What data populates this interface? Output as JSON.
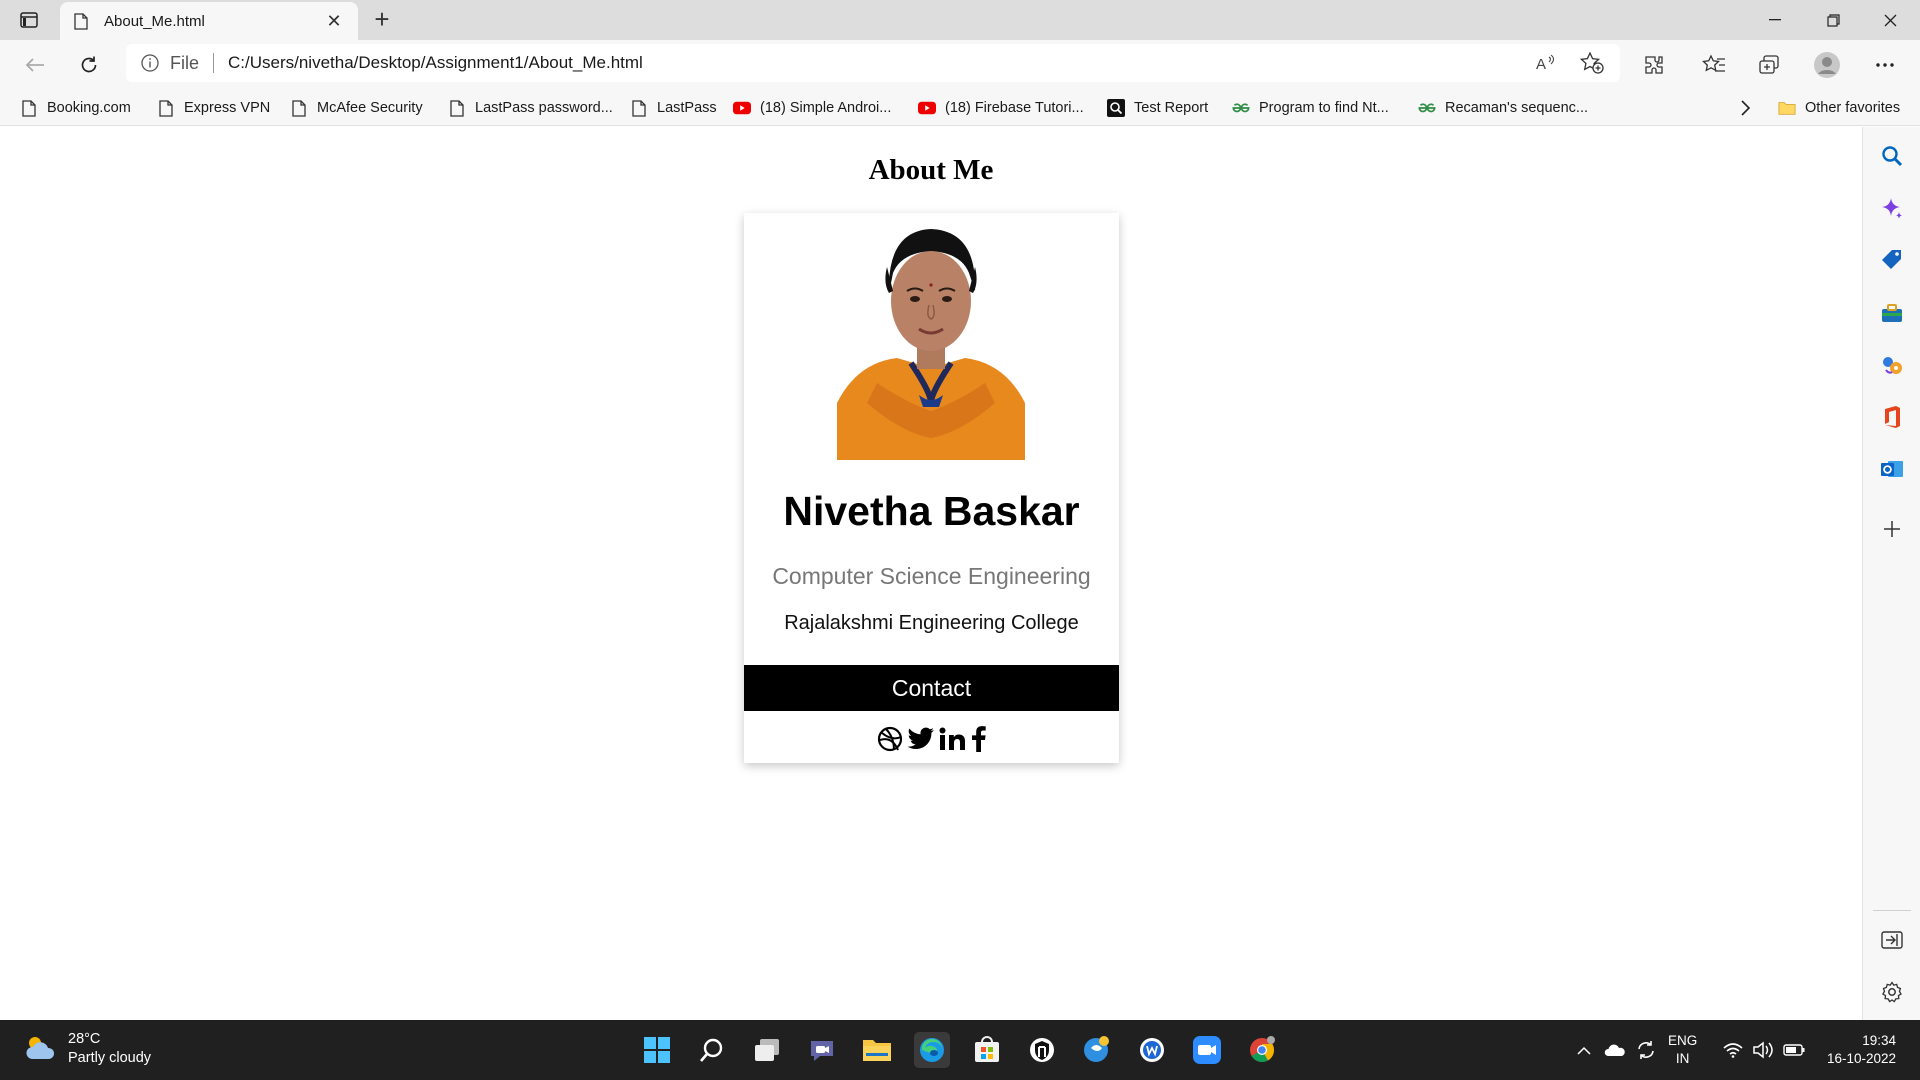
{
  "tab": {
    "title": "About_Me.html",
    "new_tab": "+",
    "close": "✕"
  },
  "address": {
    "scheme_label": "File",
    "url": "C:/Users/nivetha/Desktop/Assignment1/About_Me.html"
  },
  "bookmarks": [
    {
      "label": "Booking.com",
      "icon": "page-icon"
    },
    {
      "label": "Express VPN",
      "icon": "page-icon"
    },
    {
      "label": "McAfee Security",
      "icon": "page-icon"
    },
    {
      "label": "LastPass password...",
      "icon": "page-icon"
    },
    {
      "label": "LastPass",
      "icon": "page-icon"
    },
    {
      "label": "(18) Simple Androi...",
      "icon": "youtube-icon"
    },
    {
      "label": "(18) Firebase Tutori...",
      "icon": "youtube-icon"
    },
    {
      "label": "Test Report",
      "icon": "search-box-icon"
    },
    {
      "label": "Program to find Nt...",
      "icon": "gfg-icon"
    },
    {
      "label": "Recaman's sequenc...",
      "icon": "gfg-icon"
    }
  ],
  "other_favorites": "Other favorites",
  "page": {
    "heading": "About Me",
    "name": "Nivetha Baskar",
    "department": "Computer Science Engineering",
    "college": "Rajalakshmi Engineering College",
    "contact_label": "Contact",
    "social_links": [
      "dribbble-icon",
      "twitter-icon",
      "linkedin-icon",
      "facebook-icon"
    ]
  },
  "taskbar": {
    "temperature": "28°C",
    "weather": "Partly cloudy",
    "lang_top": "ENG",
    "lang_bottom": "IN",
    "time": "19:34",
    "date": "16-10-2022"
  },
  "colors": {
    "contact_bg": "#000000",
    "dept_text": "#777777",
    "accent": "#0067c0"
  }
}
